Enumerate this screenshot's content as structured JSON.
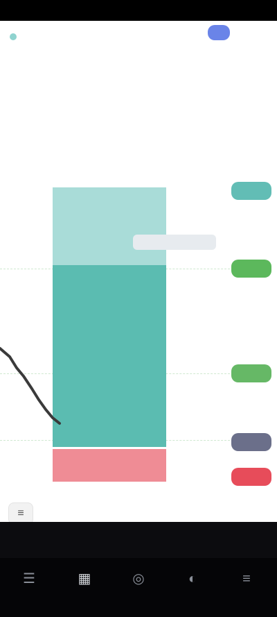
{
  "status_bar": {
    "time": "",
    "battery": ""
  },
  "header": {
    "symbol": "",
    "ohlc": "",
    "profile_chip": ""
  },
  "price_scale": {
    "ticks": []
  },
  "price_tags": {
    "target": "",
    "upper": "",
    "mid": "",
    "entry": "",
    "stop": ""
  },
  "position_tool": {
    "rr_label": ""
  },
  "colors": {
    "profit_light": "#a9dcd8",
    "profit_dark": "#5bbcb1",
    "loss": "#ef8c95",
    "accent": "#3a86ff",
    "stop_tag": "#e74c5a"
  },
  "toolbar": {
    "items": [
      "",
      "",
      "",
      ""
    ]
  },
  "nav": {
    "items": [
      {
        "label": "",
        "icon": "list-icon"
      },
      {
        "label": "",
        "icon": "chart-icon"
      },
      {
        "label": "",
        "icon": "explore-icon"
      },
      {
        "label": "",
        "icon": "community-icon"
      },
      {
        "label": "",
        "icon": "menu-icon"
      }
    ]
  }
}
